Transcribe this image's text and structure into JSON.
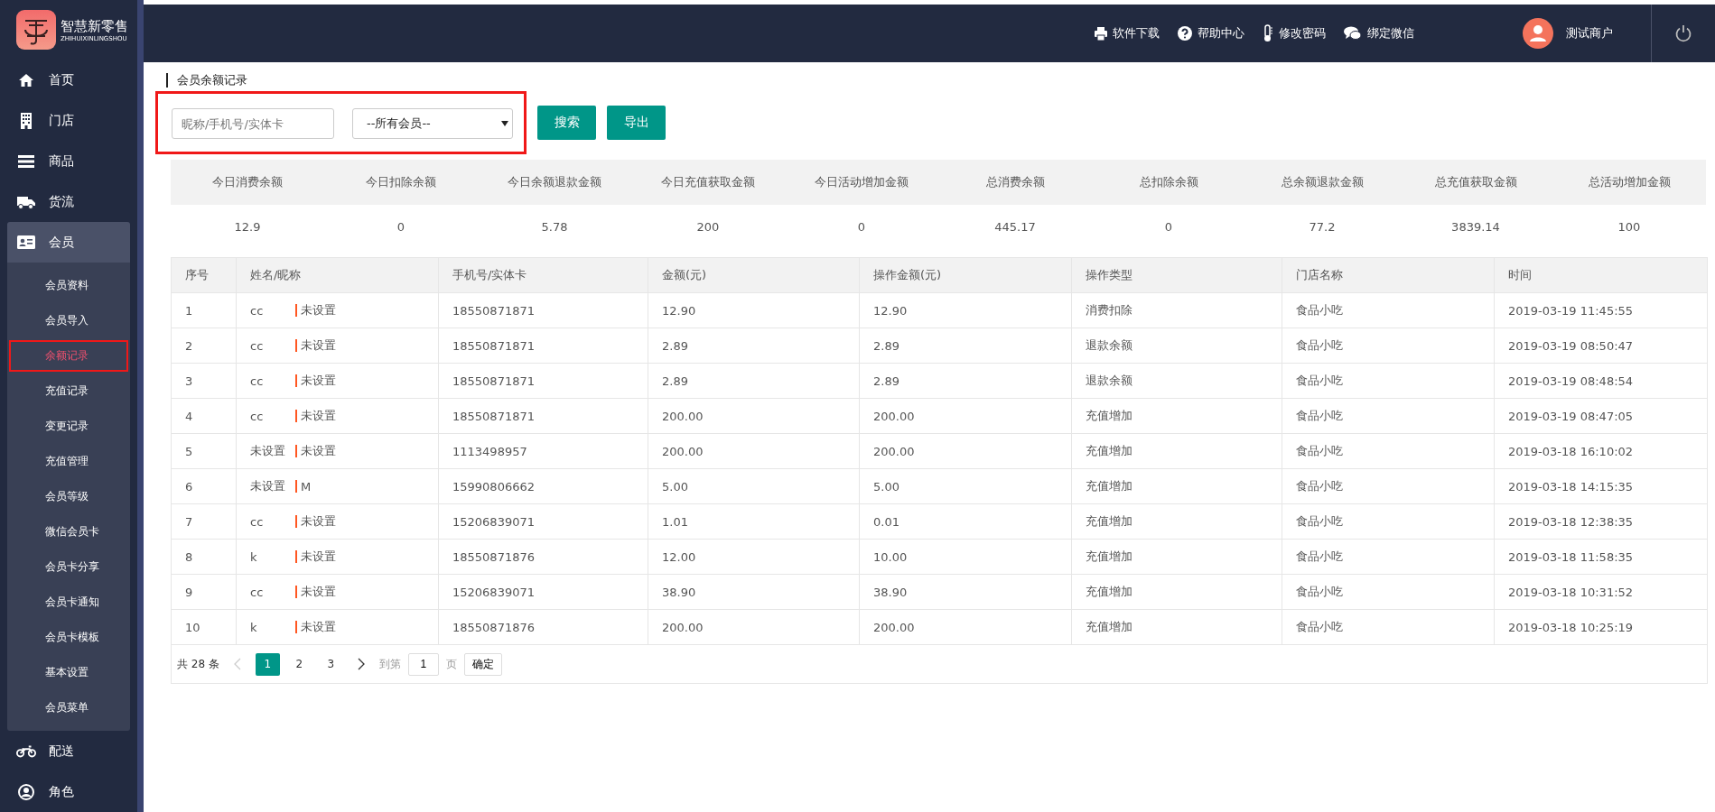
{
  "logo": {
    "title": "智慧新零售",
    "subtitle": "ZHIHUIXINLINGSHOU"
  },
  "sidebar": {
    "items": [
      {
        "label": "首页",
        "selected": false
      },
      {
        "label": "门店",
        "selected": false
      },
      {
        "label": "商品",
        "selected": false
      },
      {
        "label": "货流",
        "selected": false
      },
      {
        "label": "会员",
        "selected": true,
        "expanded": true,
        "children": [
          {
            "label": "会员资料",
            "selected": false,
            "highlighted": false
          },
          {
            "label": "会员导入",
            "selected": false,
            "highlighted": false
          },
          {
            "label": "余额记录",
            "selected": true,
            "highlighted": true
          },
          {
            "label": "充值记录",
            "selected": false,
            "highlighted": false
          },
          {
            "label": "变更记录",
            "selected": false,
            "highlighted": false
          },
          {
            "label": "充值管理",
            "selected": false,
            "highlighted": false
          },
          {
            "label": "会员等级",
            "selected": false,
            "highlighted": false
          },
          {
            "label": "微信会员卡",
            "selected": false,
            "highlighted": false
          },
          {
            "label": "会员卡分享",
            "selected": false,
            "highlighted": false
          },
          {
            "label": "会员卡通知",
            "selected": false,
            "highlighted": false
          },
          {
            "label": "会员卡模板",
            "selected": false,
            "highlighted": false
          },
          {
            "label": "基本设置",
            "selected": false,
            "highlighted": false
          },
          {
            "label": "会员菜单",
            "selected": false,
            "highlighted": false
          }
        ]
      },
      {
        "label": "配送",
        "selected": false
      },
      {
        "label": "角色",
        "selected": false
      }
    ]
  },
  "header": {
    "links": [
      "软件下载",
      "帮助中心",
      "修改密码",
      "绑定微信"
    ],
    "user": "测试商户"
  },
  "breadcrumb": "会员余额记录",
  "filter": {
    "highlighted": true,
    "search": {
      "placeholder": "昵称/手机号/实体卡"
    },
    "member_select": {
      "value": "--所有会员--"
    },
    "buttons": [
      "搜索",
      "导出"
    ]
  },
  "summary": {
    "columns": [
      "今日消费余额",
      "今日扣除余额",
      "今日余额退款金额",
      "今日充值获取金额",
      "今日活动增加金额",
      "总消费余额",
      "总扣除余额",
      "总余额退款金额",
      "总充值获取金额",
      "总活动增加金额"
    ],
    "values": [
      "12.9",
      "0",
      "5.78",
      "200",
      "0",
      "445.17",
      "0",
      "77.2",
      "3839.14",
      "100"
    ]
  },
  "table": {
    "columns": [
      "序号",
      "姓名/昵称",
      "手机号/实体卡",
      "金额(元)",
      "操作金额(元)",
      "操作类型",
      "门店名称",
      "时间"
    ],
    "rows": [
      {
        "index": "1",
        "name": "cc",
        "nickname": "未设置",
        "phone": "18550871871",
        "amount": "12.90",
        "op_amount": "12.90",
        "op_type": "消费扣除",
        "store": "食品小吃",
        "time": "2019-03-19 11:45:55"
      },
      {
        "index": "2",
        "name": "cc",
        "nickname": "未设置",
        "phone": "18550871871",
        "amount": "2.89",
        "op_amount": "2.89",
        "op_type": "退款余额",
        "store": "食品小吃",
        "time": "2019-03-19 08:50:47"
      },
      {
        "index": "3",
        "name": "cc",
        "nickname": "未设置",
        "phone": "18550871871",
        "amount": "2.89",
        "op_amount": "2.89",
        "op_type": "退款余额",
        "store": "食品小吃",
        "time": "2019-03-19 08:48:54"
      },
      {
        "index": "4",
        "name": "cc",
        "nickname": "未设置",
        "phone": "18550871871",
        "amount": "200.00",
        "op_amount": "200.00",
        "op_type": "充值增加",
        "store": "食品小吃",
        "time": "2019-03-19 08:47:05"
      },
      {
        "index": "5",
        "name": "未设置",
        "nickname": "未设置",
        "phone": "1113498957",
        "amount": "200.00",
        "op_amount": "200.00",
        "op_type": "充值增加",
        "store": "食品小吃",
        "time": "2019-03-18 16:10:02"
      },
      {
        "index": "6",
        "name": "未设置",
        "nickname": "M",
        "phone": "15990806662",
        "amount": "5.00",
        "op_amount": "5.00",
        "op_type": "充值增加",
        "store": "食品小吃",
        "time": "2019-03-18 14:15:35"
      },
      {
        "index": "7",
        "name": "cc",
        "nickname": "未设置",
        "phone": "15206839071",
        "amount": "1.01",
        "op_amount": "0.01",
        "op_type": "充值增加",
        "store": "食品小吃",
        "time": "2019-03-18 12:38:35"
      },
      {
        "index": "8",
        "name": "k",
        "nickname": "未设置",
        "phone": "18550871876",
        "amount": "12.00",
        "op_amount": "10.00",
        "op_type": "充值增加",
        "store": "食品小吃",
        "time": "2019-03-18 11:58:35"
      },
      {
        "index": "9",
        "name": "cc",
        "nickname": "未设置",
        "phone": "15206839071",
        "amount": "38.90",
        "op_amount": "38.90",
        "op_type": "充值增加",
        "store": "食品小吃",
        "time": "2019-03-18 10:31:52"
      },
      {
        "index": "10",
        "name": "k",
        "nickname": "未设置",
        "phone": "18550871876",
        "amount": "200.00",
        "op_amount": "200.00",
        "op_type": "充值增加",
        "store": "食品小吃",
        "time": "2019-03-18 10:25:19"
      }
    ]
  },
  "pagination": {
    "total": "共 28 条",
    "pages": [
      {
        "label": "1",
        "selected": true
      },
      {
        "label": "2",
        "selected": false
      },
      {
        "label": "3",
        "selected": false
      }
    ],
    "goto_label": "到第",
    "goto_value": "1",
    "page_unit": "页",
    "confirm": "确定"
  }
}
